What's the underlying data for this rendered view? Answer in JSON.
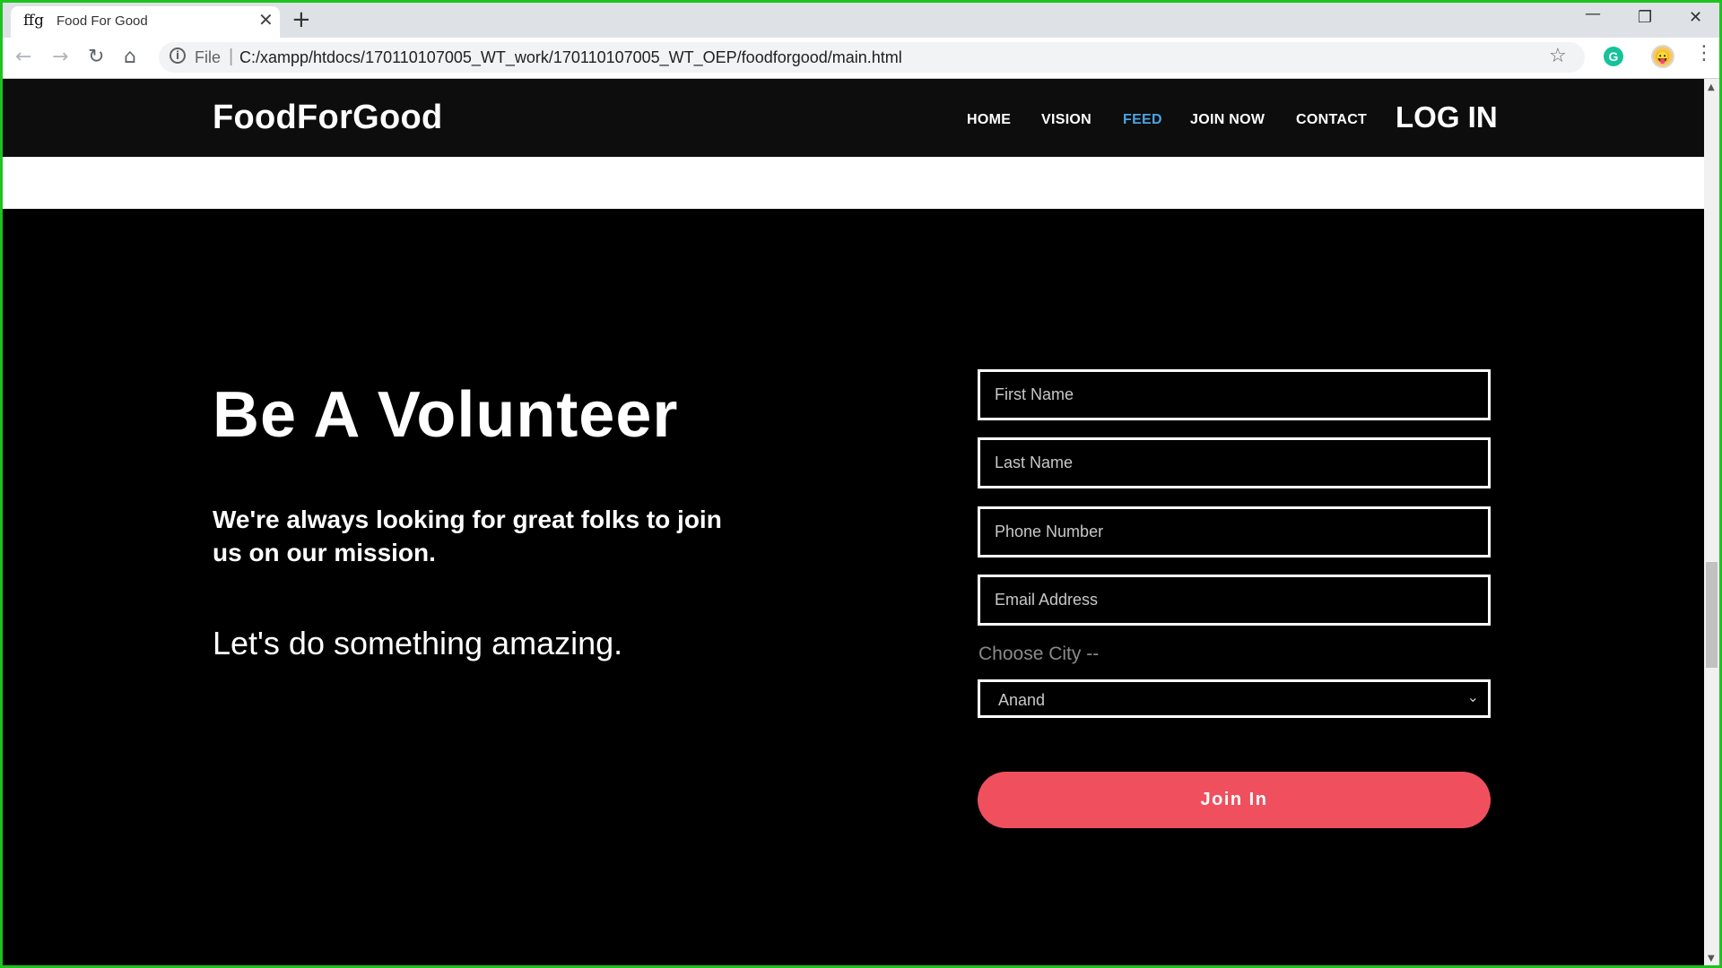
{
  "browser": {
    "tab": {
      "favicon_text": "ffg",
      "title": "Food For Good",
      "close_glyph": "✕"
    },
    "new_tab_glyph": "+",
    "window_controls": {
      "minimize": "—",
      "restore": "❐",
      "close": "✕"
    },
    "nav_glyphs": {
      "back": "←",
      "forward": "→",
      "reload": "↻",
      "home": "⌂"
    },
    "address": {
      "info_glyph": "i",
      "scheme_label": "File",
      "separator": "|",
      "url": "C:/xampp/htdocs/170110107005_WT_work/170110107005_WT_OEP/foodforgood/main.html"
    },
    "toolbar_glyphs": {
      "bookmark": "☆",
      "grammarly": "G",
      "avatar": "😛",
      "menu": "⋮"
    },
    "scroll_glyphs": {
      "up": "▲",
      "down": "▼"
    }
  },
  "site": {
    "brand": "FoodForGood",
    "nav": [
      {
        "label": "HOME",
        "active": false
      },
      {
        "label": "VISION",
        "active": false
      },
      {
        "label": "FEED",
        "active": true
      },
      {
        "label": "JOIN NOW",
        "active": false
      },
      {
        "label": "CONTACT",
        "active": false
      }
    ],
    "login_label": "LOG IN",
    "accent_color": "#4ba3e3"
  },
  "hero": {
    "title": "Be A Volunteer",
    "subtitle": "We're always looking for great folks to join us on our mission.",
    "cta_text": "Let's do something amazing."
  },
  "form": {
    "first_name_placeholder": "First Name",
    "last_name_placeholder": "Last Name",
    "phone_placeholder": "Phone Number",
    "email_placeholder": "Email Address",
    "city_label": "Choose City --",
    "city_selected": "Anand",
    "city_chevron": "⌄",
    "submit_label": "Join In",
    "submit_color": "#f0505e"
  }
}
